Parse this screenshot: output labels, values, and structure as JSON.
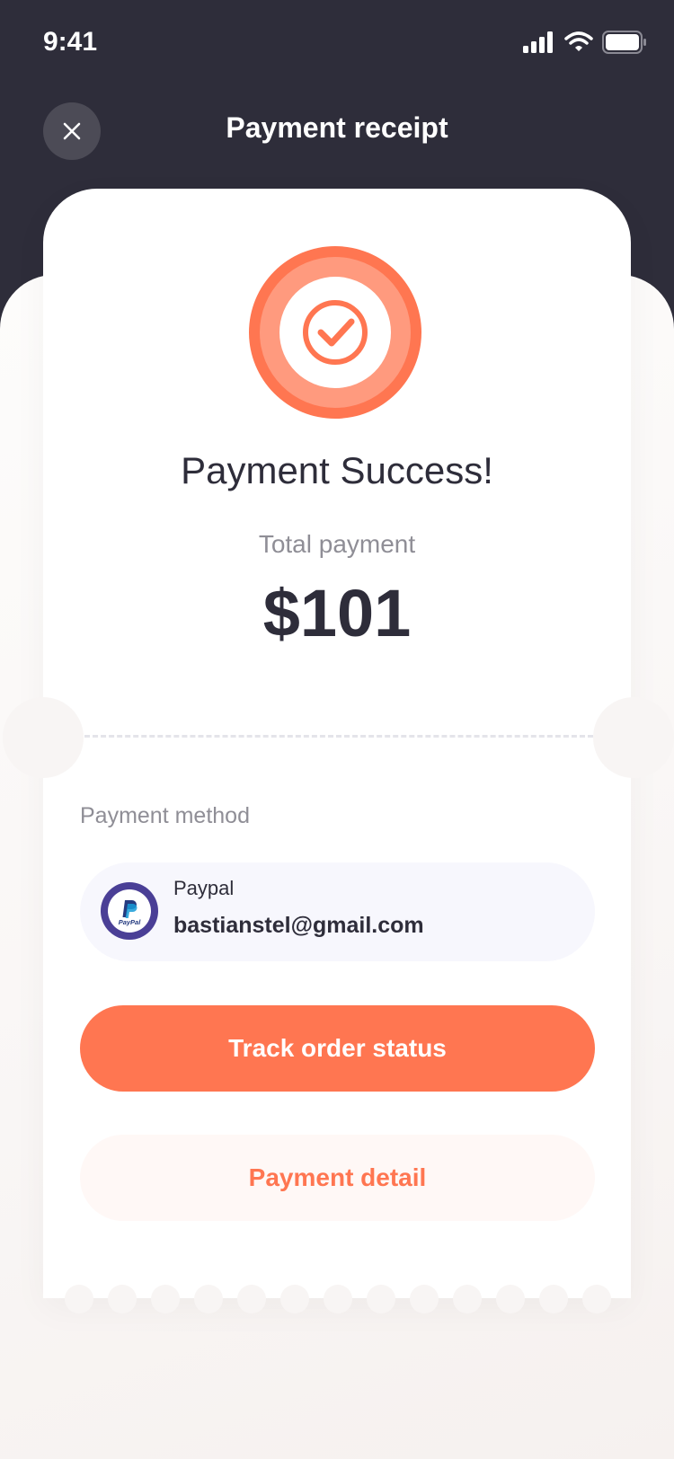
{
  "status_bar": {
    "time": "9:41",
    "icons": [
      "signal-icon",
      "wifi-icon",
      "battery-icon"
    ]
  },
  "header": {
    "title": "Payment receipt",
    "close_icon": "close-icon"
  },
  "receipt": {
    "success_icon": "check-circle-icon",
    "title": "Payment Success!",
    "total_label": "Total payment",
    "total_amount": "$101"
  },
  "payment_method": {
    "section_label": "Payment method",
    "provider": "Paypal",
    "provider_icon": "paypal-icon",
    "email": "bastianstel@gmail.com"
  },
  "actions": {
    "track_label": "Track order status",
    "detail_label": "Payment detail"
  },
  "colors": {
    "accent": "#ff7651",
    "dark": "#2e2d3a",
    "muted": "#8f8e96",
    "paypal_purple": "#4a3f96"
  }
}
